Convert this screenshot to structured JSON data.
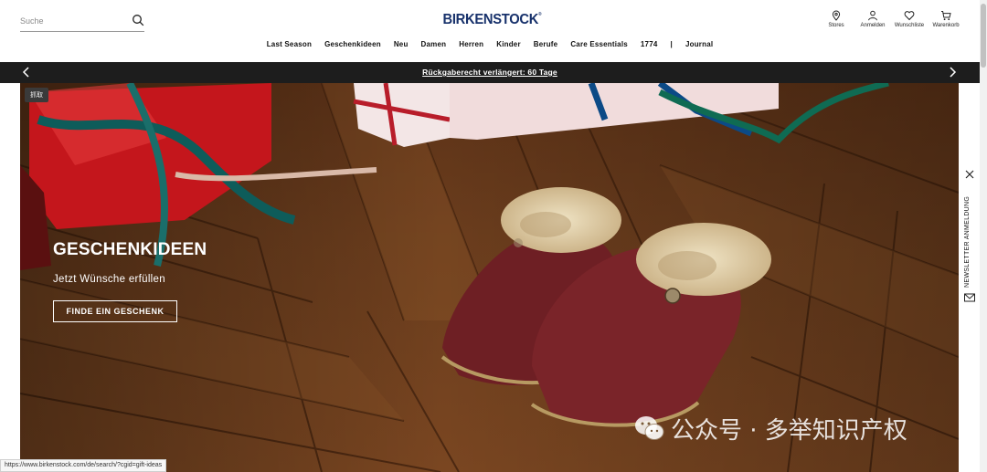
{
  "search": {
    "placeholder": "Suche",
    "value": ""
  },
  "logo": {
    "text": "BIRKENSTOCK",
    "mark": "®"
  },
  "utilities": [
    {
      "label": "Stores",
      "icon": "location-pin-icon"
    },
    {
      "label": "Anmelden",
      "icon": "user-icon"
    },
    {
      "label": "Wunschliste",
      "icon": "heart-icon"
    },
    {
      "label": "Warenkorb",
      "icon": "cart-icon"
    }
  ],
  "nav": {
    "items": [
      "Last Season",
      "Geschenkideen",
      "Neu",
      "Damen",
      "Herren",
      "Kinder",
      "Berufe",
      "Care Essentials",
      "1774",
      "|",
      "Journal"
    ]
  },
  "promo": {
    "text": "Rückgaberecht verlängert: 60 Tage"
  },
  "hero": {
    "tag": "抓取",
    "title": "GESCHENKIDEEN",
    "subtitle": "Jetzt Wünsche erfüllen",
    "cta": "FINDE EIN GESCHENK"
  },
  "newsletter": {
    "label": "NEWSLETTER ANMELDUNG"
  },
  "watermark": {
    "text": "公众号 · 多举知识产权"
  },
  "status_url": "https://www.birkenstock.com/de/search/?cgid=gift-ideas",
  "colors": {
    "logo": "#17316b",
    "promo_bar": "#1d1d1d",
    "slipper": "#6e1f24"
  }
}
